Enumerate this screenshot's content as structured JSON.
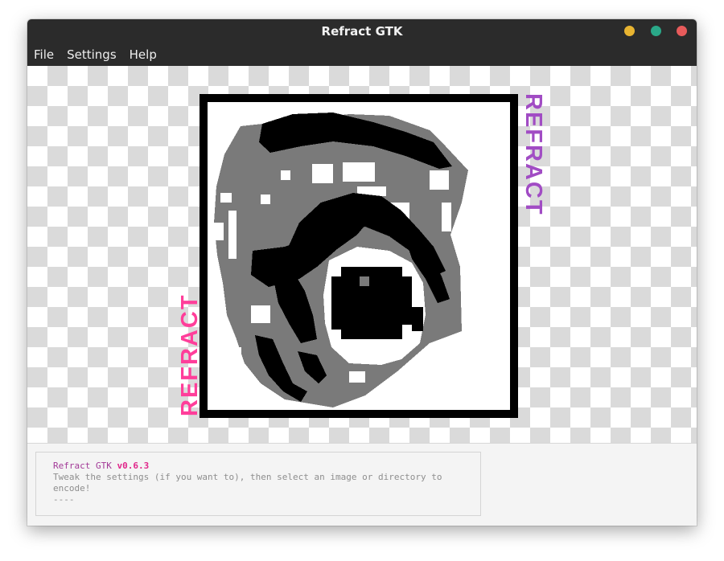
{
  "window": {
    "title": "Refract GTK"
  },
  "controls": {
    "minimize_color": "#e8b431",
    "maximize_color": "#2aa888",
    "close_color": "#e85b5b"
  },
  "menu": {
    "items": [
      "File",
      "Settings",
      "Help"
    ]
  },
  "logo": {
    "text": "REFRACT",
    "left_color": "#ff3e9a",
    "right_color": "#a14cc4"
  },
  "console": {
    "app_name": "Refract GTK",
    "version": "v0.6.3",
    "message": "Tweak the settings (if you want to), then select an image or directory to encode!",
    "separator": "----"
  }
}
